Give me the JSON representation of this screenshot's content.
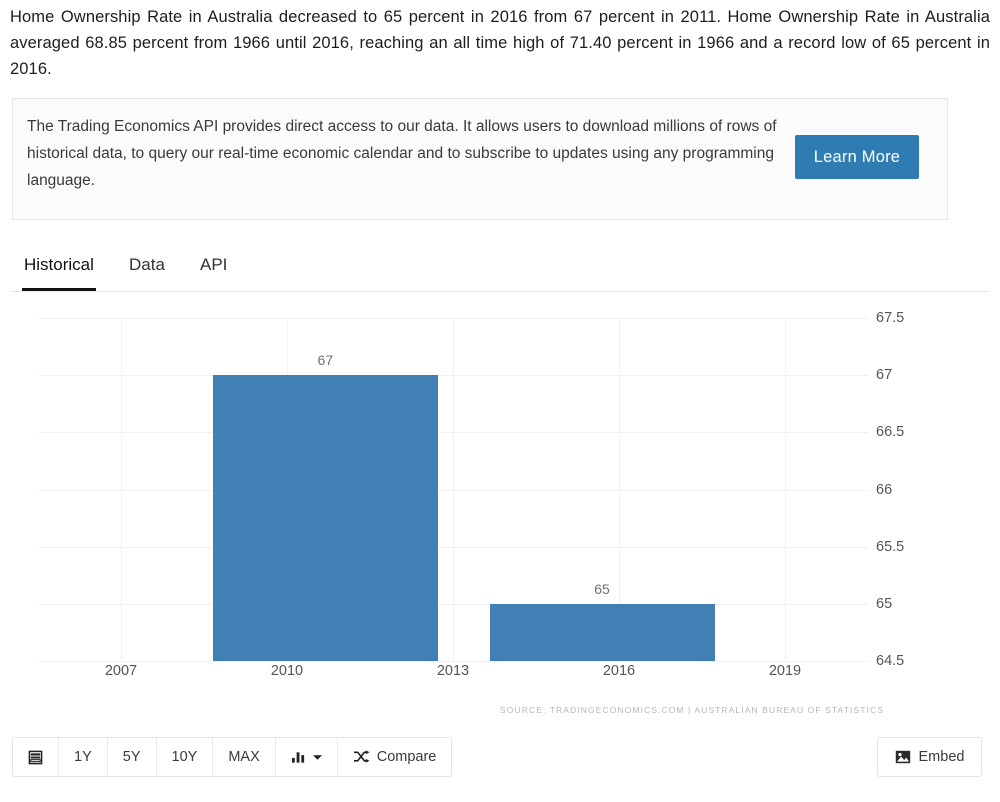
{
  "intro": {
    "text": "Home Ownership Rate in Australia decreased to 65 percent in 2016 from 67 percent in 2011. Home Ownership Rate in Australia averaged 68.85 percent from 1966 until 2016, reaching an all time high of 71.40 percent in 1966 and a record low of 65 percent in 2016."
  },
  "api_promo": {
    "text": "The Trading Economics API provides direct access to our data. It allows users to download millions of rows of historical data, to query our real-time economic calendar and to subscribe to updates using any programming language.",
    "button_label": "Learn More",
    "button_color": "#2f7cb2"
  },
  "tabs": [
    {
      "label": "Historical",
      "active": true
    },
    {
      "label": "Data",
      "active": false
    },
    {
      "label": "API",
      "active": false
    }
  ],
  "toolbar": {
    "buttons": [
      {
        "label": "",
        "icon": "calendar-list-icon"
      },
      {
        "label": "1Y",
        "icon": ""
      },
      {
        "label": "5Y",
        "icon": ""
      },
      {
        "label": "10Y",
        "icon": ""
      },
      {
        "label": "MAX",
        "icon": ""
      },
      {
        "label": "",
        "icon": "bar-chart-dropdown-icon"
      },
      {
        "label": "Compare",
        "icon": "shuffle-icon"
      }
    ],
    "embed_label": "Embed",
    "embed_icon": "image-icon"
  },
  "chart_data": {
    "type": "bar",
    "title": "",
    "xlabel": "",
    "ylabel": "",
    "categories": [
      "2011",
      "2016"
    ],
    "values": [
      67,
      65
    ],
    "data_labels": [
      "67",
      "65"
    ],
    "bar_color": "#4180b4",
    "ylim": [
      64.5,
      67.5
    ],
    "yticks": [
      "67.5",
      "67",
      "66.5",
      "66",
      "65.5",
      "65",
      "64.5"
    ],
    "ytick_values": [
      67.5,
      67,
      66.5,
      66,
      65.5,
      65,
      64.5
    ],
    "xticks": [
      "2007",
      "2010",
      "2013",
      "2016",
      "2019"
    ],
    "xtick_values": [
      2007,
      2010,
      2013,
      2016,
      2019
    ],
    "xlim": [
      2005.5,
      2020.5
    ],
    "grid": true,
    "legend": false,
    "source": "SOURCE: TRADINGECONOMICS.COM  |  AUSTRALIAN BUREAU OF STATISTICS"
  }
}
